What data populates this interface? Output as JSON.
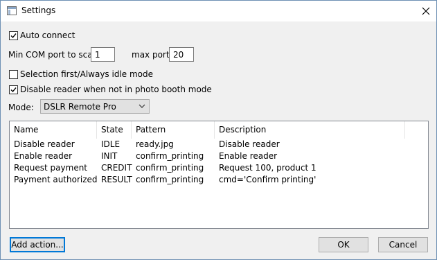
{
  "window": {
    "title": "Settings"
  },
  "options": {
    "auto_connect": {
      "label": "Auto connect",
      "checked": true
    },
    "selection_first": {
      "label": "Selection first/Always idle mode",
      "checked": false
    },
    "disable_reader": {
      "label": "Disable reader when not in photo booth mode",
      "checked": true
    }
  },
  "ports": {
    "min_label": "Min COM port to scan:",
    "min_value": "1",
    "max_label": "max port:",
    "max_value": "20"
  },
  "mode": {
    "label": "Mode:",
    "selected": "DSLR Remote Pro"
  },
  "actions": {
    "columns": [
      "Name",
      "State",
      "Pattern",
      "Description"
    ],
    "rows": [
      [
        "Disable reader",
        "IDLE",
        "ready.jpg",
        "Disable reader"
      ],
      [
        "Enable reader",
        "INIT",
        "confirm_printing",
        "Enable reader"
      ],
      [
        "Request payment",
        "CREDIT",
        "confirm_printing",
        "Request 100, product 1"
      ],
      [
        "Payment authorized",
        "RESULT",
        "confirm_printing",
        "cmd='Confirm printing'"
      ]
    ]
  },
  "buttons": {
    "add_action": "Add action...",
    "ok": "OK",
    "cancel": "Cancel"
  },
  "icons": {
    "app": "window-icon",
    "close": "close-icon",
    "check": "checkmark-icon",
    "dropdown": "chevron-down-icon"
  }
}
